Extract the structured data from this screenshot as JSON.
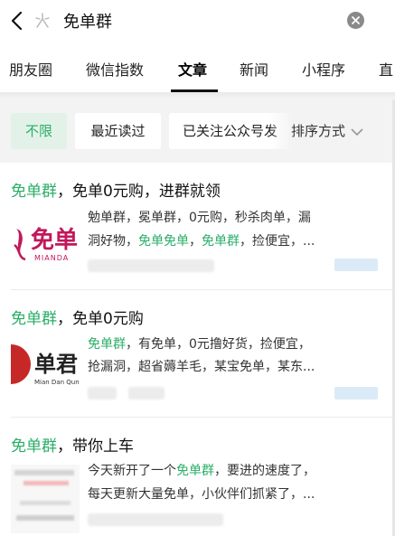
{
  "search": {
    "query": "免单群"
  },
  "tabs": [
    {
      "label": "朋友圈"
    },
    {
      "label": "微信指数"
    },
    {
      "label": "文章"
    },
    {
      "label": "新闻"
    },
    {
      "label": "小程序"
    },
    {
      "label": "直"
    }
  ],
  "filters": {
    "unlimited": "不限",
    "recently_read": "最近读过",
    "followed": "已关注公众号发",
    "sort": "排序方式"
  },
  "results": [
    {
      "title_hl": "免单群",
      "title_rest": "，免单0元购，进群就领",
      "snippet_line1": "勉单群，冕单群，0元购，秒杀肉单，漏",
      "snippet_line2": [
        {
          "t": "洞好物，",
          "hl": false
        },
        {
          "t": "免单免单",
          "hl": true
        },
        {
          "t": "，",
          "hl": false
        },
        {
          "t": "免单群",
          "hl": true
        },
        {
          "t": "，捡便宜，...",
          "hl": false
        }
      ],
      "thumb_text": "免单",
      "thumb_sub": "MIANDA"
    },
    {
      "title_hl": "免单群",
      "title_rest": "，免单0元购",
      "snippet_line1": [
        {
          "t": "免单群",
          "hl": true
        },
        {
          "t": "，有免单，0元撸好货，捡便宜，",
          "hl": false
        }
      ],
      "snippet_line2": "抢漏洞，超省薅羊毛，某宝免单，某东...",
      "thumb_text": "单君",
      "thumb_sub": "Mian Dan Qun"
    },
    {
      "title_hl": "免单群",
      "title_rest": "，带你上车",
      "snippet_line1": [
        {
          "t": "今天新开了一个",
          "hl": false
        },
        {
          "t": "免单群",
          "hl": true
        },
        {
          "t": "，要进的速度了，",
          "hl": false
        }
      ],
      "snippet_line2": "每天更新大量免单，小伙伴们抓紧了，..."
    }
  ],
  "colors": {
    "highlight": "#2aae67",
    "chip_active_bg": "#e3f2e8",
    "brand_pink": "#c2185b",
    "brand_red": "#c62828"
  },
  "icons": [
    "back-icon",
    "search-icon",
    "clear-icon",
    "chevron-down-icon"
  ]
}
